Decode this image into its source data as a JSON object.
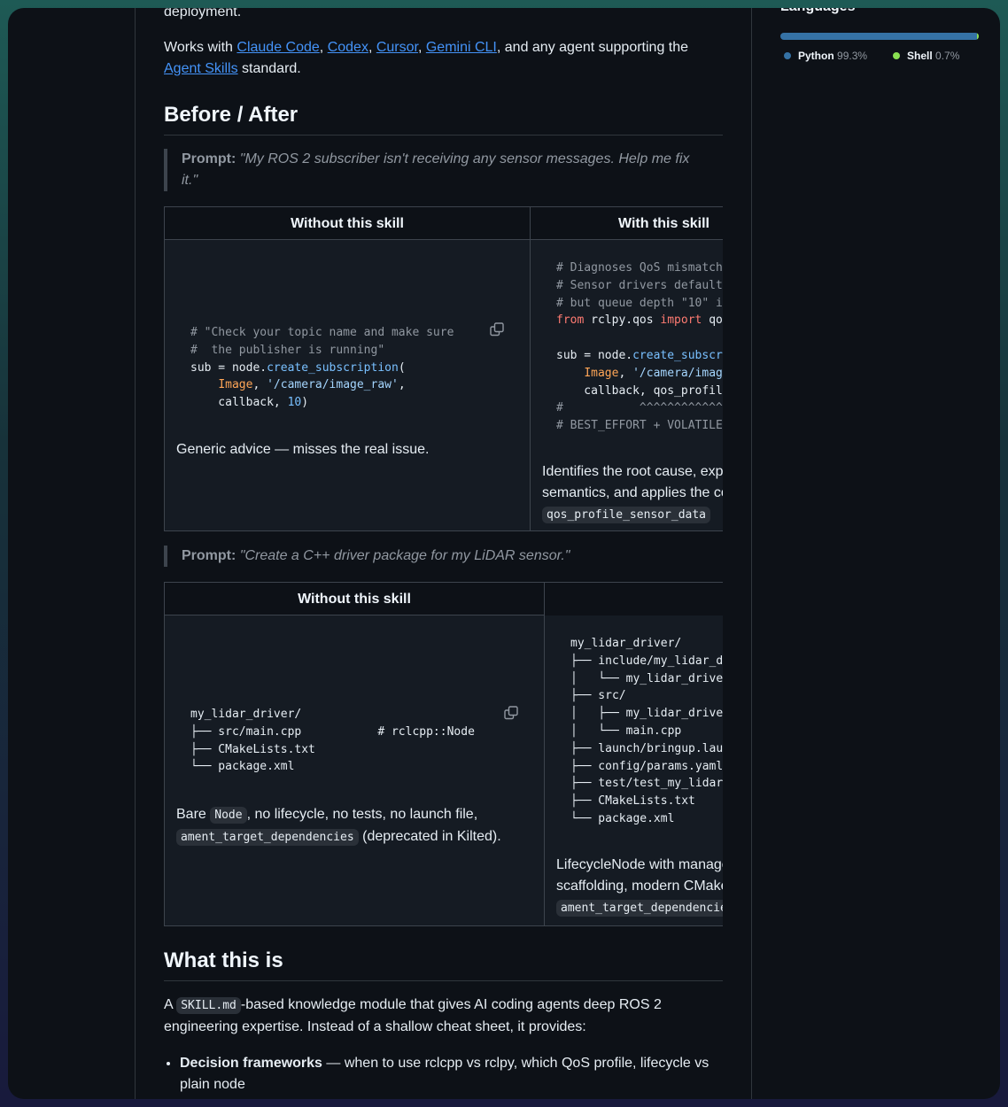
{
  "readme": {
    "intro_tail": "deployment.",
    "works_with_prefix": "Works with ",
    "works_with_links": [
      "Claude Code",
      "Codex",
      "Cursor",
      "Gemini CLI",
      "Agent Skills"
    ],
    "works_with_mid": ", and any agent supporting the",
    "works_with_suffix": " standard.",
    "before_after_heading": "Before / After",
    "prompt_label": "Prompt:",
    "prompt1": "\"My ROS 2 subscriber isn't receiving any sensor messages. Help me fix it.\"",
    "prompt2": "\"Create a C++ driver package for my LiDAR sensor.\"",
    "col_without": "Without this skill",
    "col_with": "With this skill",
    "table1": {
      "without_note": "Generic advice — misses the real issue.",
      "with_note": "Identifies the root cause, explains QoS compatibility semantics, and applies the correct",
      "with_code": "qos_profile_sensor_data"
    },
    "table2": {
      "without_note_1": "Bare ",
      "without_code_1": "Node",
      "without_note_2": ", no lifecycle, no tests, no launch file,",
      "without_code_2": "ament_target_dependencies",
      "without_note_3": " (deprecated in Kilted).",
      "with_note": "LifecycleNode with managed states, launch and test scaffolding, modern CMake targets instead of",
      "with_code": "ament_target_dependencies"
    },
    "what_heading": "What this is",
    "what_p1": "A ",
    "what_code": "SKILL.md",
    "what_p2": "-based knowledge module that gives AI coding agents deep ROS 2 engineering expertise. Instead of a shallow cheat sheet, it provides:",
    "bullet1_bold": "Decision frameworks",
    "bullet1_text": " — when to use rclcpp vs rclpy, which QoS profile, lifecycle vs plain node"
  },
  "sidebar": {
    "languages_title": "Languages",
    "languages": [
      {
        "name": "Python",
        "percent": "99.3%",
        "color": "#3572a5"
      },
      {
        "name": "Shell",
        "percent": "0.7%",
        "color": "#89e051"
      }
    ]
  },
  "icons": {
    "copy": "copy-icon"
  }
}
